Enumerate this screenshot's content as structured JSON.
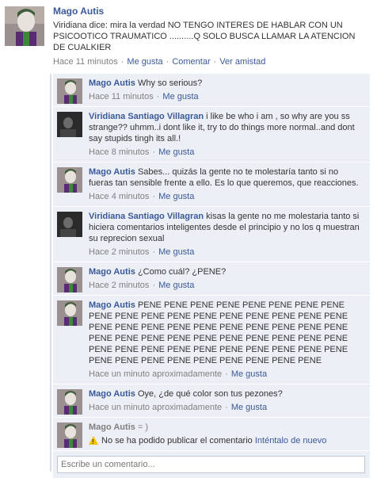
{
  "post": {
    "author": "Mago Autis",
    "text": "Viridiana dice: mira la verdad NO TENGO INTERES DE HABLAR CON UN PSICOOTICO TRAUMATICO ..........Q SOLO BUSCA LLAMAR LA ATENCION DE CUALKIER",
    "time": "Hace 11 minutos",
    "like": "Me gusta",
    "comment": "Comentar",
    "see_friendship": "Ver amistad"
  },
  "comments": [
    {
      "author": "Mago Autis",
      "text": "Why so serious?",
      "time": "Hace 11 minutos",
      "like": "Me gusta",
      "avatar": "joker"
    },
    {
      "author": "Viridiana Santiago Villagran",
      "text": "i like be who i am , so why are you ss strange?? uhmm..i dont like it, try to do things more normal..and dont say stupids tingh its all.!",
      "time": "Hace 8 minutos",
      "like": "Me gusta",
      "avatar": "dark"
    },
    {
      "author": "Mago Autis",
      "text": "Sabes... quizás la gente no te molestaría tanto si no fueras tan sensible frente a ello. Es lo que queremos, que reacciones.",
      "time": "Hace 4 minutos",
      "like": "Me gusta",
      "avatar": "joker"
    },
    {
      "author": "Viridiana Santiago Villagran",
      "text": "kisas la gente no me molestaria tanto si hiciera comentarios inteligentes desde el principio y no los q muestran su reprecion sexual",
      "time": "Hace 2 minutos",
      "like": "Me gusta",
      "avatar": "dark"
    },
    {
      "author": "Mago Autis",
      "text": "¿Como cuál? ¿PENE?",
      "time": "Hace 2 minutos",
      "like": "Me gusta",
      "avatar": "joker"
    },
    {
      "author": "Mago Autis",
      "text": "PENE PENE PENE PENE PENE PENE PENE PENE PENE PENE PENE PENE PENE PENE PENE PENE PENE PENE PENE PENE PENE PENE PENE PENE PENE PENE PENE PENE PENE PENE PENE PENE PENE PENE PENE PENE PENE PENE PENE PENE PENE PENE PENE PENE PENE PENE PENE PENE PENE PENE PENE PENE PENE PENE PENE PENE PENE",
      "time": "Hace un minuto aproximadamente",
      "like": "Me gusta",
      "avatar": "joker"
    },
    {
      "author": "Mago Autis",
      "text": "Oye, ¿de qué color son tus pezones?",
      "time": "Hace un minuto aproximadamente",
      "like": "Me gusta",
      "avatar": "joker"
    }
  ],
  "failed": {
    "author": "Mago Autis",
    "text": "= )",
    "error": "No se ha podido publicar el comentario",
    "retry": "Inténtalo de nuevo"
  },
  "composer": {
    "placeholder": "Escribe un comentario..."
  },
  "icons": {
    "warning": "warning-icon"
  },
  "colors": {
    "link": "#3b5998",
    "comment_bg": "#eceff5",
    "meta_gray": "#808080"
  }
}
